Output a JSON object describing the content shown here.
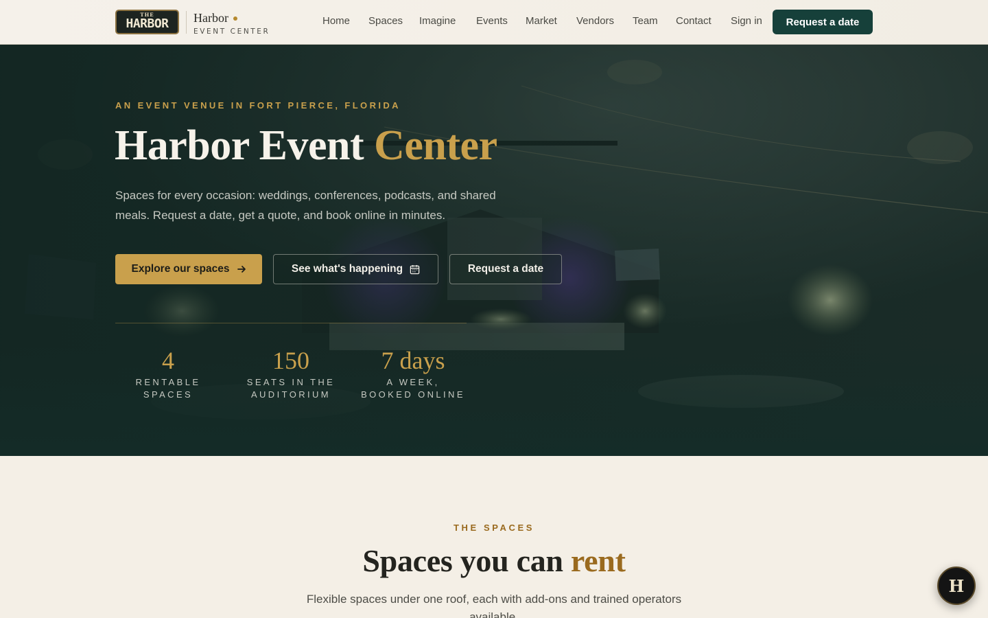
{
  "brand": {
    "logo_the": "THE",
    "logo_word": "HARBOR",
    "name": "Harbor",
    "subtitle": "EVENT CENTER"
  },
  "nav": {
    "links": [
      "Home",
      "Spaces",
      "Imagine",
      "Events",
      "Market",
      "Vendors",
      "Team",
      "Contact",
      "Sign in"
    ],
    "cta": "Request a date"
  },
  "hero": {
    "eyebrow": "AN EVENT VENUE IN FORT PIERCE, FLORIDA",
    "title_main": "Harbor Event ",
    "title_accent": "Center",
    "description": "Spaces for every occasion: weddings, conferences, podcasts, and shared meals. Request a date, get a quote, and book online in minutes.",
    "buttons": {
      "explore": "Explore our spaces",
      "events": "See what's happening",
      "request": "Request a date"
    },
    "stats": [
      {
        "value": "4",
        "label_line1": "RENTABLE",
        "label_line2": "SPACES"
      },
      {
        "value": "150",
        "label_line1": "SEATS IN THE",
        "label_line2": "AUDITORIUM"
      },
      {
        "value": "7 days",
        "label_line1": "A WEEK,",
        "label_line2": "BOOKED ONLINE"
      }
    ]
  },
  "spaces_section": {
    "eyebrow": "THE SPACES",
    "title_main": "Spaces you can ",
    "title_accent": "rent",
    "description": "Flexible spaces under one roof, each with add-ons and trained operators available."
  },
  "chat_fab": {
    "letter": "H"
  },
  "colors": {
    "accent_gold": "#c9a04c",
    "brand_green": "#16403a",
    "section_accent": "#9a6a1e",
    "cream": "#f4efe6"
  }
}
